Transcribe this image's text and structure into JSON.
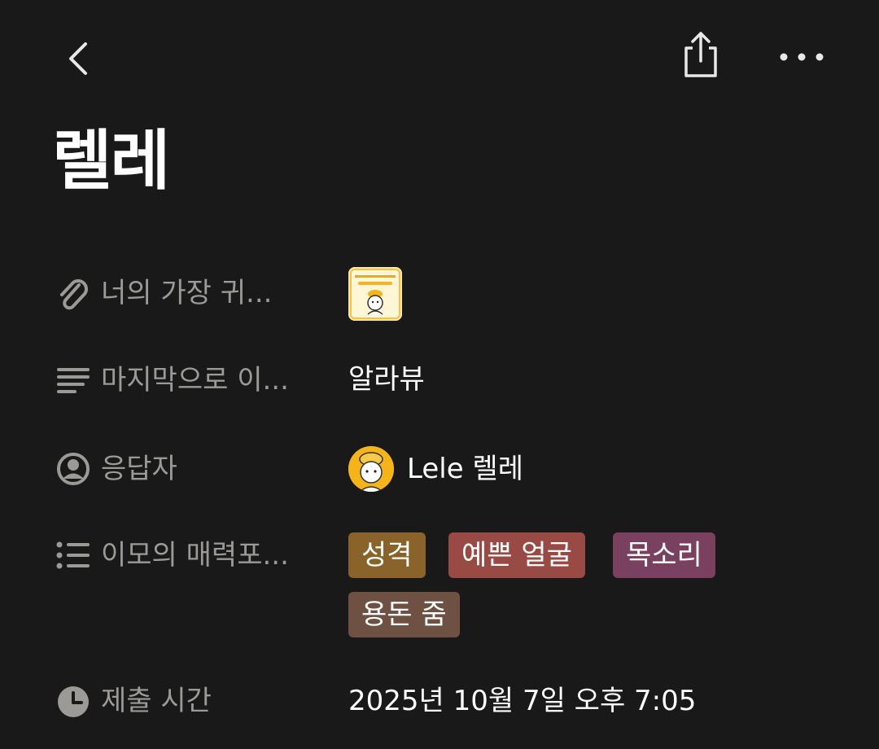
{
  "header": {
    "back_icon": "chevron-left-icon",
    "share_icon": "share-icon",
    "more_icon": "more-horizontal-icon"
  },
  "page": {
    "title": "렐레"
  },
  "properties": [
    {
      "icon": "paperclip-icon",
      "label": "너의 가장 귀...",
      "type": "file"
    },
    {
      "icon": "text-lines-icon",
      "label": "마지막으로 이...",
      "value": "알라뷰"
    },
    {
      "icon": "person-circle-icon",
      "label": "응답자",
      "value": "Lele 렐레"
    },
    {
      "icon": "list-icon",
      "label": "이모의 매력포...",
      "tags": [
        {
          "text": "성격",
          "color": "#89632a"
        },
        {
          "text": "예쁜 얼굴",
          "color": "#9a4a44"
        },
        {
          "text": "목소리",
          "color": "#7a4060"
        },
        {
          "text": "용돈 줌",
          "color": "#6e5142"
        }
      ]
    },
    {
      "icon": "clock-icon",
      "label": "제출 시간",
      "value": "2025년 10월 7일 오후 7:05"
    }
  ],
  "colors": {
    "background": "#191919",
    "label": "#9b9a97",
    "text": "#ffffff"
  }
}
